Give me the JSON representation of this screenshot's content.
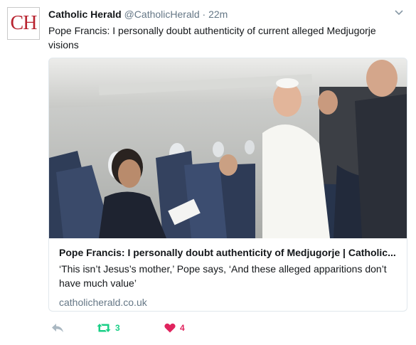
{
  "tweet": {
    "avatar_text": "CH",
    "author_name": "Catholic Herald",
    "author_handle": "@CatholicHerald",
    "separator": "·",
    "time": "22m",
    "text": "Pope Francis: I personally doubt authenticity of current alleged Medjugorje visions"
  },
  "card": {
    "title": "Pope Francis: I personally doubt authenticity of Medjugorje | Catholic...",
    "description": "‘This isn’t Jesus’s mother,’ Pope says, ‘And these alleged apparitions don’t have much value’",
    "domain": "catholicherald.co.uk"
  },
  "actions": {
    "reply_icon": "reply-icon",
    "retweet_icon": "retweet-icon",
    "retweet_count": "3",
    "like_icon": "heart-icon",
    "like_count": "4"
  },
  "colors": {
    "brand_red": "#b8232f",
    "retweet_green": "#19cf86",
    "like_red": "#e0245e",
    "secondary_text": "#657786"
  }
}
